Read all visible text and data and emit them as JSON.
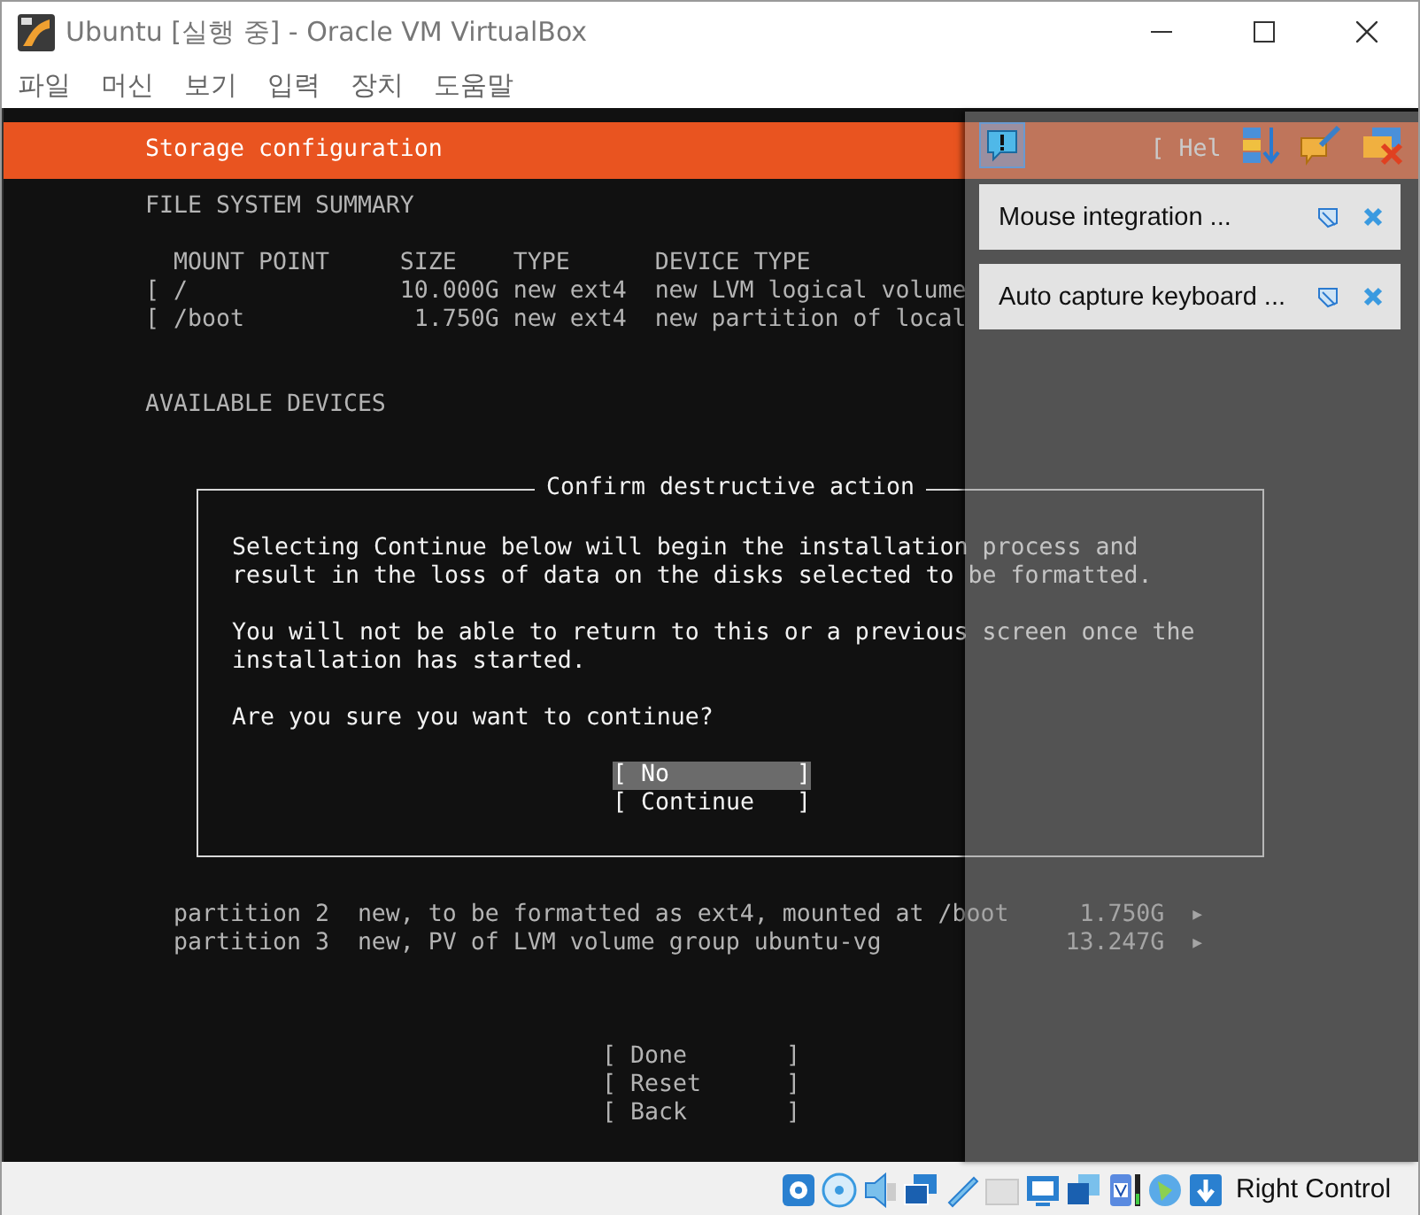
{
  "window": {
    "title": "Ubuntu [실행 중] - Oracle VM VirtualBox"
  },
  "menu": [
    "파일",
    "머신",
    "보기",
    "입력",
    "장치",
    "도움말"
  ],
  "installer": {
    "title": "Storage configuration",
    "help": "[ Hel",
    "summary_heading": "FILE SYSTEM SUMMARY",
    "columns": [
      "MOUNT POINT",
      "SIZE",
      "TYPE",
      "DEVICE TYPE"
    ],
    "mounts": [
      {
        "bracket": "[",
        "mount_point": "/",
        "size": "10.000G",
        "type": "new ext4",
        "device_type": "new LVM logical volume"
      },
      {
        "bracket": "[",
        "mount_point": "/boot",
        "size": "1.750G",
        "type": "new ext4",
        "device_type": "new partition of local"
      }
    ],
    "devices_heading": "AVAILABLE DEVICES",
    "partitions": [
      {
        "name": "partition 2",
        "description": "new, to be formatted as ext4, mounted at /boot",
        "size": "1.750G",
        "arrow": "▶"
      },
      {
        "name": "partition 3",
        "description": "new, PV of LVM volume group ubuntu-vg",
        "size": "13.247G",
        "arrow": "▶"
      }
    ],
    "actions": [
      {
        "label": "[ Done       ]",
        "selected": false
      },
      {
        "label": "[ Reset      ]",
        "selected": false
      },
      {
        "label": "[ Back       ]",
        "selected": false
      }
    ]
  },
  "dialog": {
    "title": "Confirm destructive action",
    "paragraphs": [
      "Selecting Continue below will begin the installation process and result in the loss of data on the disks selected to be formatted.",
      "You will not be able to return to this or a previous screen once the installation has started.",
      "Are you sure you want to continue?"
    ],
    "buttons": [
      {
        "label": "[ No         ]",
        "selected": true
      },
      {
        "label": "[ Continue   ]",
        "selected": false
      }
    ]
  },
  "notifications": [
    {
      "text": "Mouse integration ..."
    },
    {
      "text": "Auto capture keyboard ..."
    }
  ],
  "status_bar": {
    "host_key": "Right Control"
  }
}
